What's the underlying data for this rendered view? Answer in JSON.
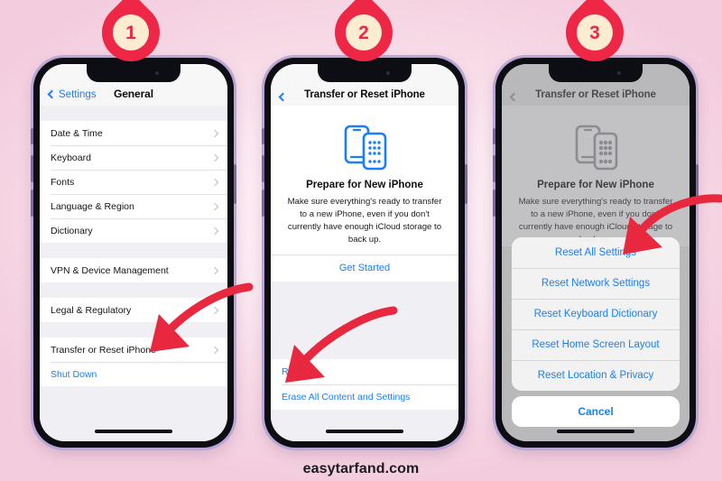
{
  "watermark": "easytarfand.com",
  "accent_colors": {
    "arrow_red": "#e8283f",
    "badge_red": "#ee2746",
    "badge_disc": "#fbecd2",
    "ios_blue": "#1a7ef5",
    "background_pink": "#f7d9e6"
  },
  "badges": [
    {
      "number": "1"
    },
    {
      "number": "2"
    },
    {
      "number": "3"
    }
  ],
  "steps": [
    {
      "phone_label": "step-1-general-settings",
      "navbar": {
        "back_label": "Settings",
        "title": "General"
      },
      "groups": [
        {
          "rows": [
            {
              "label": "Date & Time",
              "accessory": "chevron-right-icon"
            },
            {
              "label": "Keyboard",
              "accessory": "chevron-right-icon"
            },
            {
              "label": "Fonts",
              "accessory": "chevron-right-icon"
            },
            {
              "label": "Language & Region",
              "accessory": "chevron-right-icon"
            },
            {
              "label": "Dictionary",
              "accessory": "chevron-right-icon"
            }
          ]
        },
        {
          "rows": [
            {
              "label": "VPN & Device Management",
              "accessory": "chevron-right-icon"
            }
          ]
        },
        {
          "rows": [
            {
              "label": "Legal & Regulatory",
              "accessory": "chevron-right-icon"
            }
          ]
        },
        {
          "rows": [
            {
              "label": "Transfer or Reset iPhone",
              "accessory": "chevron-right-icon"
            },
            {
              "label": "Shut Down",
              "accessory": "none",
              "style": "blue"
            }
          ]
        }
      ],
      "arrow_target": "Transfer or Reset iPhone"
    },
    {
      "phone_label": "step-2-transfer-or-reset",
      "navbar": {
        "back_label": "",
        "title": "Transfer or Reset iPhone"
      },
      "hero": {
        "icon": "two-iphones-icon",
        "heading": "Prepare for New iPhone",
        "description": "Make sure everything's ready to transfer to a new iPhone, even if you don't currently have enough iCloud storage to back up.",
        "cta_label": "Get Started"
      },
      "bottom_rows": [
        {
          "label": "Reset"
        },
        {
          "label": "Erase All Content and Settings"
        }
      ],
      "arrow_target": "Reset"
    },
    {
      "phone_label": "step-3-reset-action-sheet",
      "navbar": {
        "back_label": "",
        "title": "Transfer or Reset iPhone"
      },
      "hero": {
        "icon": "two-iphones-icon",
        "heading": "Prepare for New iPhone",
        "description": "Make sure everything's ready to transfer to a new iPhone, even if you don't currently have enough iCloud storage to back up."
      },
      "action_sheet": {
        "options": [
          {
            "label": "Reset All Settings"
          },
          {
            "label": "Reset Network Settings"
          },
          {
            "label": "Reset Keyboard Dictionary"
          },
          {
            "label": "Reset Home Screen Layout"
          },
          {
            "label": "Reset Location & Privacy"
          }
        ],
        "cancel_label": "Cancel"
      },
      "arrow_target": "Reset Network Settings"
    }
  ]
}
